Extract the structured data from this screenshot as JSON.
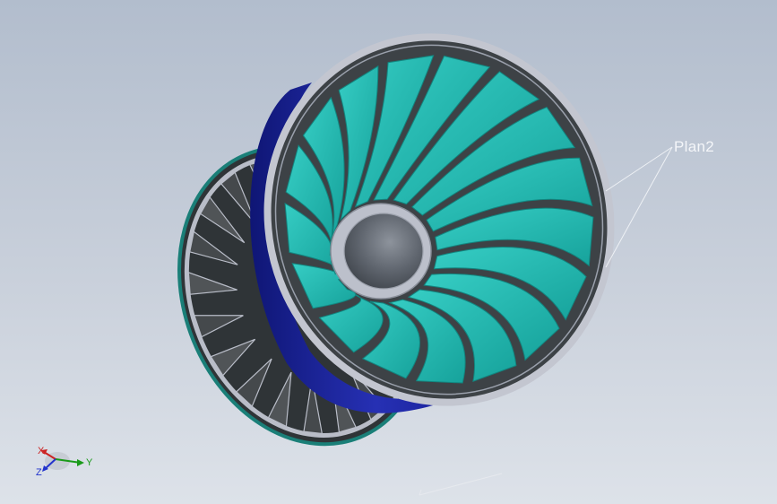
{
  "viewport": {
    "background_top": "#b2bdcd",
    "background_bottom": "#dde2e9"
  },
  "model": {
    "name": "turbine-runner",
    "colors": {
      "blades": "#1fb8b0",
      "blade_shadow": "#12857f",
      "band": "#1a23a0",
      "rims": "#b8bcc8",
      "hub_interior": "#4e535c",
      "dark_blades": "#505457"
    },
    "front_blade_count": 17,
    "rear_blade_count": 20
  },
  "annotations": {
    "plane_label": "Plan2"
  },
  "triad": {
    "x_label": "X",
    "y_label": "Y",
    "z_label": "Z",
    "x_color": "#cc2222",
    "y_color": "#1a9a1a",
    "z_color": "#2233cc"
  }
}
